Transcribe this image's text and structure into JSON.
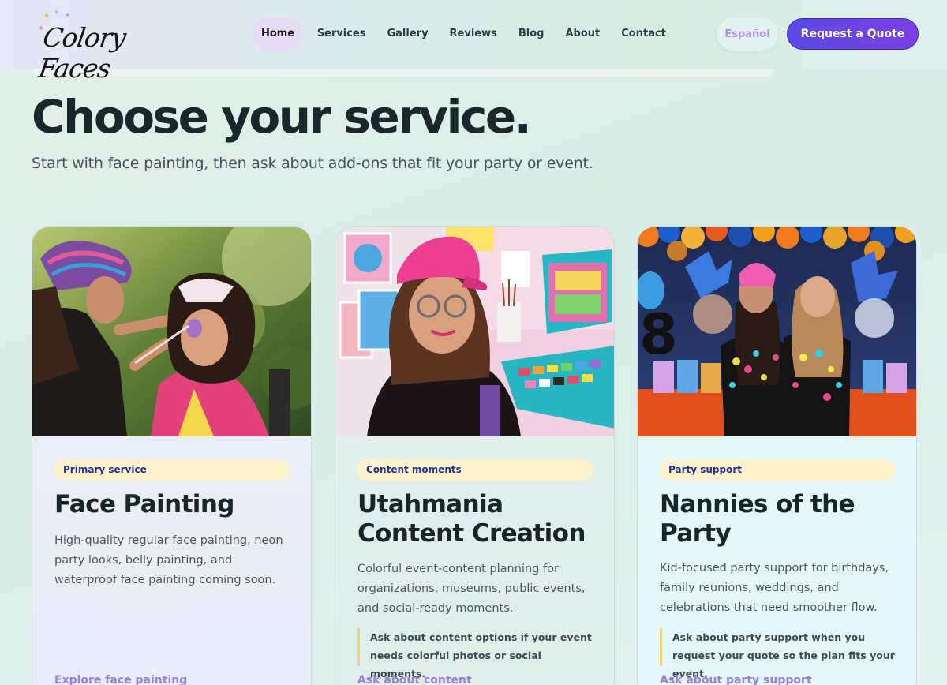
{
  "header": {
    "logo_text": "Colory Faces",
    "nav": [
      "Home",
      "Services",
      "Gallery",
      "Reviews",
      "Blog",
      "About",
      "Contact"
    ],
    "active_nav": "Home",
    "language_button": "Español",
    "cta_button": "Request a Quote"
  },
  "hero": {
    "title": "Choose your service.",
    "subtitle": "Start with face painting, then ask about add-ons that fit your party or event."
  },
  "cards": [
    {
      "badge": "Primary service",
      "title": "Face Painting",
      "description": "High-quality regular face painting, neon party looks, belly painting, and waterproof face painting coming soon.",
      "note": "",
      "link": "Explore face painting"
    },
    {
      "badge": "Content moments",
      "title": "Utahmania Content Creation",
      "description": "Colorful event-content planning for organizations, museums, public events, and social-ready moments.",
      "note": "Ask about content options if your event needs colorful photos or social moments.",
      "link": "Ask about content"
    },
    {
      "badge": "Party support",
      "title": "Nannies of the Party",
      "description": "Kid-focused party support for birthdays, family reunions, weddings, and celebrations that need smoother flow.",
      "note": "Ask about party support when you request your quote so the plan fits your event.",
      "link": "Ask about party support"
    }
  ],
  "colors": {
    "accent": "#6a44e4",
    "badge_bg": "#fbf2cc",
    "badge_text": "#24308a",
    "link": "#9b7fd9",
    "language": "#b392e6"
  }
}
